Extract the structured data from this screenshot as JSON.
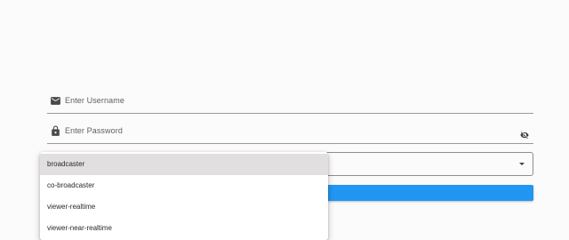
{
  "form": {
    "username_placeholder": "Enter Username",
    "password_placeholder": "Enter Password",
    "role_dropdown": {
      "options": [
        "broadcaster",
        "co-broadcaster",
        "viewer-realtime",
        "viewer-near-realtime"
      ],
      "highlighted": "broadcaster"
    }
  },
  "colors": {
    "background": "#fcfbfc",
    "accent": "#2196f3",
    "highlight": "#e2dfe0"
  },
  "icons": {
    "username": "envelope-icon",
    "password": "lock-icon",
    "visibility": "eye-off-icon",
    "dropdown": "caret-down-icon"
  }
}
